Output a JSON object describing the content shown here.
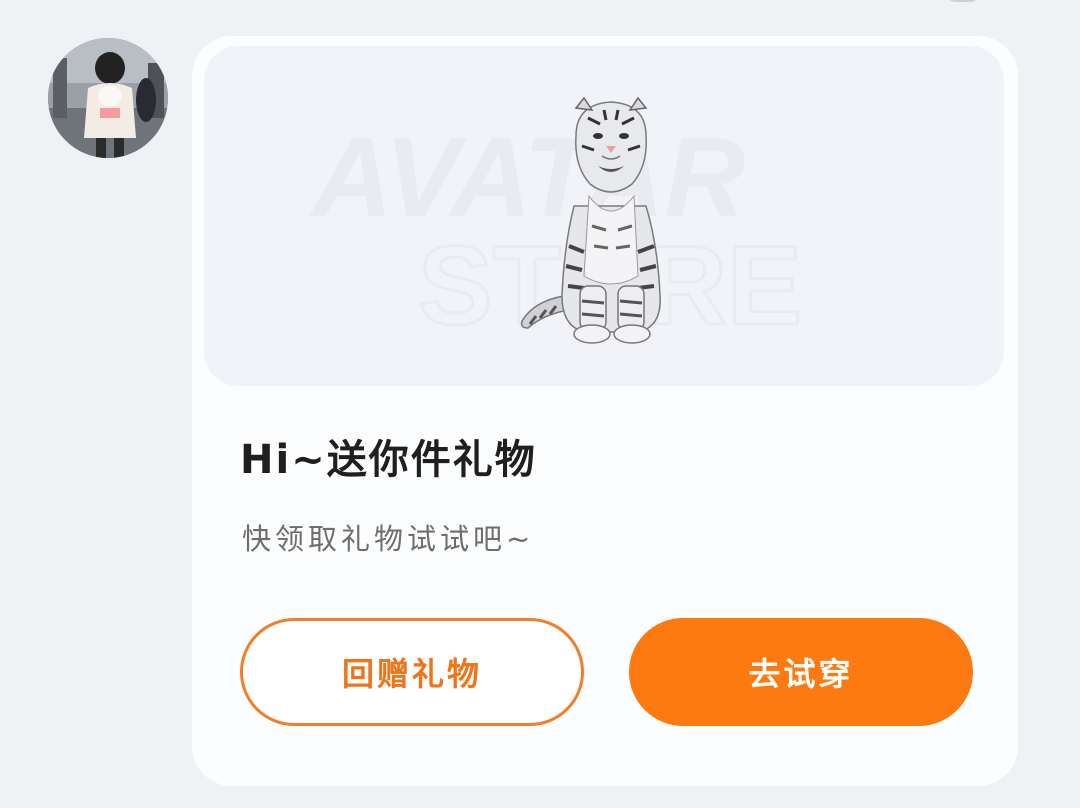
{
  "gift_card": {
    "banner": {
      "watermark_line1": "AVATAR",
      "watermark_line2": "STORE"
    },
    "title": "Hi~送你件礼物",
    "subtitle": "快领取礼物试试吧~",
    "buttons": {
      "return_gift": "回赠礼物",
      "try_on": "去试穿"
    }
  },
  "colors": {
    "accent": "#fd7a10",
    "outline": "#f17e2a",
    "card_bg": "#fcfdfe",
    "page_bg": "#f0f1f5"
  },
  "icons": {
    "avatar": "user-avatar-photo",
    "gift": "white-tiger-figure"
  }
}
